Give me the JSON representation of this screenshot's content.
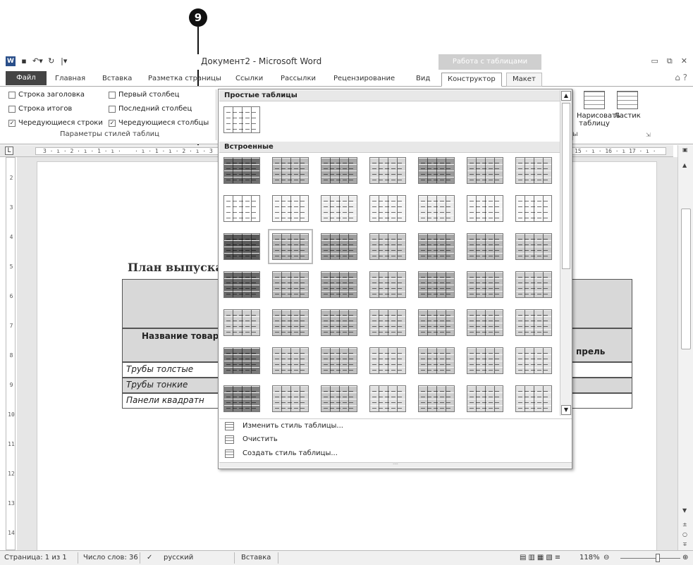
{
  "callout": "9",
  "window": {
    "title": "Документ2 - Microsoft Word",
    "context_group": "Работа с таблицами",
    "qat_icons": [
      "word-icon",
      "save-icon",
      "undo-icon",
      "redo-icon",
      "customize-icon"
    ]
  },
  "tabs": {
    "file": "Файл",
    "home": "Главная",
    "insert": "Вставка",
    "page_layout": "Разметка страницы",
    "references": "Ссылки",
    "mailings": "Рассылки",
    "review": "Рецензирование",
    "view": "Вид",
    "design": "Конструктор",
    "layout": "Макет"
  },
  "ribbon": {
    "options": {
      "header_row": "Строка заголовка",
      "total_row": "Строка итогов",
      "banded_rows": "Чередующиеся строки",
      "first_column": "Первый столбец",
      "last_column": "Последний столбец",
      "banded_columns": "Чередующиеся столбцы"
    },
    "group_label": "Параметры стилей таблиц",
    "draw_table": "Нарисовать таблицу",
    "draw_line1": "Нарисовать",
    "draw_line2": "таблицу",
    "eraser": "Ластик",
    "group2_label_tail": "ы"
  },
  "dropdown": {
    "plain_header": "Простые таблицы",
    "builtin_header": "Встроенные",
    "menu": {
      "modify": "Изменить стиль таблицы...",
      "clear": "Очистить",
      "new": "Создать стиль таблицы..."
    },
    "rows": [
      [
        "#6f6f6f",
        "#bdbdbd",
        "#a8a8a8",
        "#d6d6d6",
        "#9a9a9a",
        "#c8c8c8",
        "#d9d9d9"
      ],
      [
        "#ffffff",
        "#f6f6f6",
        "#eeeeee",
        "#f3f3f3",
        "#ececec",
        "#f5f5f5",
        "#f8f8f8"
      ],
      [
        "#5a5a5a",
        "#b5b5b5",
        "#9d9d9d",
        "#c9c9c9",
        "#a5a5a5",
        "#bcbcbc",
        "#cacaca"
      ],
      [
        "#6a6a6a",
        "#bababa",
        "#a4a4a4",
        "#cdcdcd",
        "#a9a9a9",
        "#c2c2c2",
        "#d0d0d0"
      ],
      [
        "#d0d0d0",
        "#c4c4c4",
        "#b8b8b8",
        "#d2d2d2",
        "#bfbfbf",
        "#cccccc",
        "#d7d7d7"
      ],
      [
        "#7a7a7a",
        "#cfcfcf",
        "#c1c1c1",
        "#dddddd",
        "#cbcbcb",
        "#d5d5d5",
        "#e0e0e0"
      ],
      [
        "#808080",
        "#d4d4d4",
        "#c6c6c6",
        "#e0e0e0",
        "#cecece",
        "#dadada",
        "#e3e3e3"
      ]
    ]
  },
  "document": {
    "heading": "План выпуска",
    "col_header": "Название товар",
    "col_right": "прель",
    "rows": [
      "Трубы толстые",
      "Трубы тонкие",
      "Панели квадратн"
    ]
  },
  "ruler": {
    "h_left": "3 · ı · 2 · ı · 1 · ı ·",
    "h_mid": "· ı · 1 · ı · 2 · ı · 3",
    "h_right": "15 · ı · 16 · ı  17 · ı ·",
    "v_marks": [
      "2",
      "3",
      "4",
      "5",
      "6",
      "7",
      "8",
      "9",
      "10",
      "11",
      "12",
      "13",
      "14"
    ]
  },
  "status": {
    "page": "Страница: 1 из 1",
    "words": "Число слов: 36",
    "language": "русский",
    "mode": "Вставка",
    "zoom": "118%"
  }
}
